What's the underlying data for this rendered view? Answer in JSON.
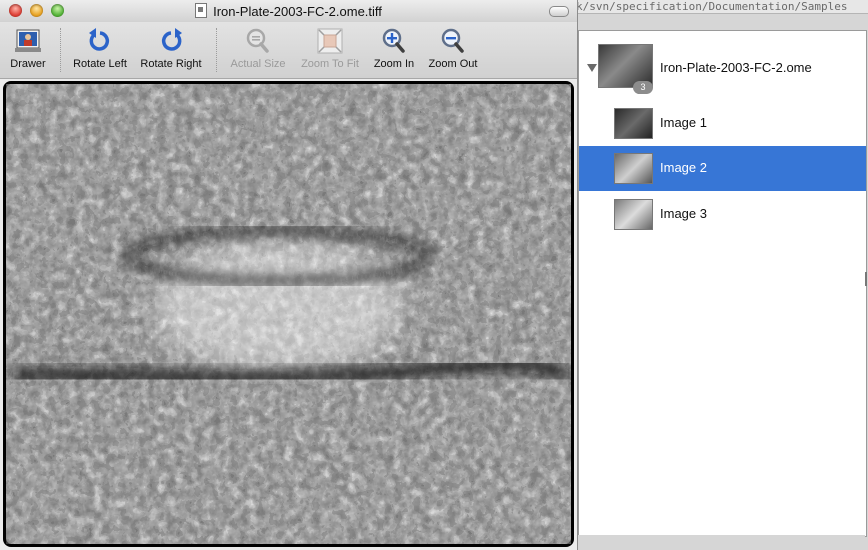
{
  "window": {
    "title": "Iron-Plate-2003-FC-2.ome.tiff",
    "background_path": "k/svn/specification/Documentation/Samples"
  },
  "toolbar": {
    "items": [
      {
        "label": "Drawer",
        "icon": "drawer-icon",
        "enabled": true
      },
      {
        "label": "Rotate Left",
        "icon": "rotate-left-icon",
        "enabled": true
      },
      {
        "label": "Rotate Right",
        "icon": "rotate-right-icon",
        "enabled": true
      },
      {
        "label": "Actual Size",
        "icon": "actual-size-icon",
        "enabled": false
      },
      {
        "label": "Zoom To Fit",
        "icon": "zoom-to-fit-icon",
        "enabled": false
      },
      {
        "label": "Zoom In",
        "icon": "zoom-in-icon",
        "enabled": true
      },
      {
        "label": "Zoom Out",
        "icon": "zoom-out-icon",
        "enabled": true
      }
    ]
  },
  "drawer": {
    "file": {
      "name": "Iron-Plate-2003-FC-2.ome",
      "count": "3",
      "expanded": true
    },
    "images": [
      {
        "label": "Image 1",
        "selected": false
      },
      {
        "label": "Image 2",
        "selected": true
      },
      {
        "label": "Image 3",
        "selected": false
      }
    ]
  },
  "colors": {
    "selection": "#3776d6",
    "toolbar_icon_blue": "#2b63c9"
  }
}
